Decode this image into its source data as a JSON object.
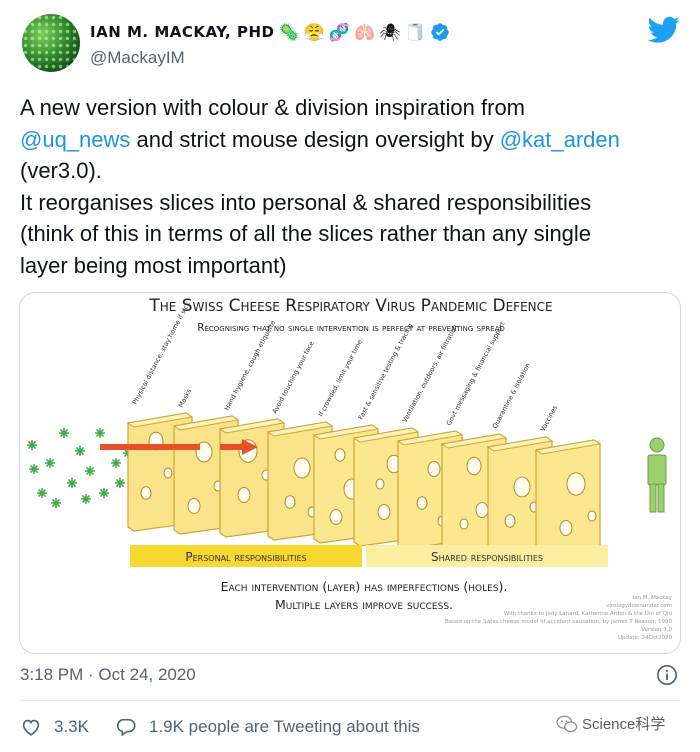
{
  "author": {
    "display_name": "IAN M. MACKAY, PHD",
    "emojis": [
      "🦠",
      "😤",
      "🧬",
      "🫁",
      "🕷",
      "🧻"
    ],
    "handle": "@MackayIM"
  },
  "tweet": {
    "line1": "A new version with colour & division inspiration from",
    "mention1": "@uq_news",
    "mid1": " and strict mouse design oversight by ",
    "mention2": "@kat_arden",
    "line3": "(ver3.0).",
    "line4": "It reorganises slices into personal & shared responsibilities",
    "line5": "(think of this in terms of all the slices rather than any single",
    "line6": "layer being most important)"
  },
  "infographic": {
    "title": "The Swiss Cheese Respiratory Virus Pandemic Defence",
    "subtitle": "Recognising that no single intervention is perfect at preventing spread",
    "slice_labels": [
      "Physical distance, stay home if sick",
      "Masks",
      "Hand hygiene, cough etiquette",
      "Avoid touching your face",
      "If crowded, limit your time",
      "Fast & sensitive testing & tracing",
      "Ventilation, outdoors, air filtration",
      "Govt messaging & financial support",
      "Quarantine & isolation",
      "Vaccines"
    ],
    "personal_label": "Personal responsibilities",
    "shared_label": "Shared responsibilities",
    "caption1": "Each intervention (layer) has imperfections (holes).",
    "caption2": "Multiple layers improve success.",
    "credit1": "Ian M. Mackay",
    "credit2": "virologydownunder.com",
    "credit3": "With thanks to Jody Lanard, Katherine Arden & the Uni of Qld",
    "credit4": "Based on the Swiss cheese model of accident causation, by James T Reason, 1990",
    "credit5": "Version 3.0",
    "credit6": "Update: 24Oct2020",
    "colors": {
      "personal": "#f7d830",
      "shared": "#fbeea0",
      "cheese": "#fbe88e",
      "virus": "#3fae49",
      "arrow": "#e8502a",
      "person": "#9ccf6e"
    }
  },
  "footer": {
    "timestamp": "3:18 PM · Oct 24, 2020",
    "likes": "3.3K",
    "tweeting": "1.9K people are Tweeting about this",
    "watermark": "Science科学"
  }
}
